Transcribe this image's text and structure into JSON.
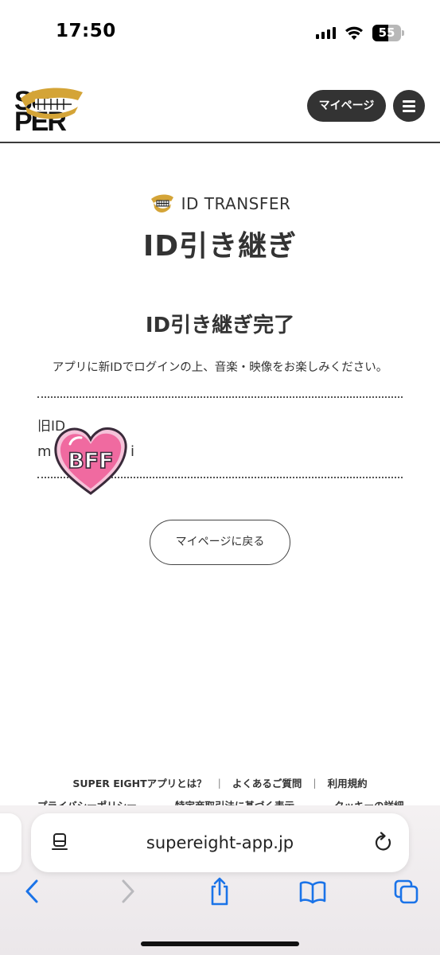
{
  "status_bar": {
    "time": "17:50",
    "battery": "55",
    "battery_level": 0.55
  },
  "header": {
    "logo_alt": "SUPER EIGHT",
    "mypage_label": "マイページ"
  },
  "page": {
    "label": "ID TRANSFER",
    "title": "ID引き継ぎ",
    "section_title": "ID引き継ぎ完了",
    "message": "アプリに新IDでログインの上、音楽・映像をお楽しみください。",
    "old_id_label": "旧ID",
    "old_id_value_start": "m",
    "old_id_value_end": "i",
    "sticker_text": "BFF",
    "back_button": "マイページに戻る"
  },
  "footer": {
    "links": [
      "SUPER EIGHTアプリとは？",
      "よくあるご質問",
      "利用規約"
    ],
    "links_row2": [
      "プライバシーポリシー",
      "特定商取引法に基づく表示",
      "クッキーの詳細"
    ]
  },
  "browser": {
    "url": "supereight-app.jp"
  },
  "colors": {
    "accent": "#333333",
    "gold": "#d4a437",
    "sticker_pink": "#f06aa0",
    "link_blue": "#1a73e8"
  },
  "icons": [
    "reader-icon",
    "reload-icon",
    "back-icon",
    "forward-icon",
    "share-icon",
    "bookmarks-icon",
    "tabs-icon",
    "menu-icon",
    "teeth-icon"
  ]
}
